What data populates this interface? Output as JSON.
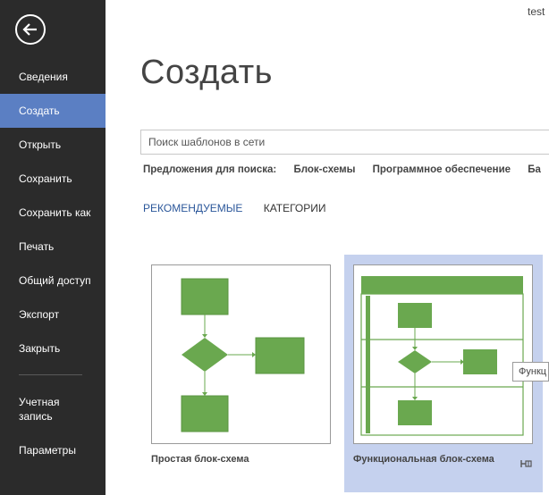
{
  "user": {
    "name": "test"
  },
  "sidebar": {
    "items": [
      {
        "label": "Сведения"
      },
      {
        "label": "Создать",
        "active": true
      },
      {
        "label": "Открыть"
      },
      {
        "label": "Сохранить"
      },
      {
        "label": "Сохранить как"
      },
      {
        "label": "Печать"
      },
      {
        "label": "Общий доступ"
      },
      {
        "label": "Экспорт"
      },
      {
        "label": "Закрыть"
      },
      {
        "label": "Учетная запись"
      },
      {
        "label": "Параметры"
      }
    ]
  },
  "main": {
    "title": "Создать",
    "search": {
      "placeholder": "Поиск шаблонов в сети",
      "value": ""
    },
    "suggestions": {
      "label": "Предложения для поиска:",
      "items": [
        "Блок-схемы",
        "Программное обеспечение",
        "Ба"
      ]
    },
    "tabs": [
      {
        "label": "РЕКОМЕНДУЕМЫЕ",
        "active": true
      },
      {
        "label": "КАТЕГОРИИ",
        "active": false
      }
    ],
    "templates": [
      {
        "label": "Простая блок-схема"
      },
      {
        "label": "Функциональная блок-схема",
        "highlighted": true
      }
    ],
    "tooltip": "Функц"
  },
  "colors": {
    "sidebar_bg": "#2b2b2b",
    "sidebar_active": "#5b7fc3",
    "accent": "#2b579a",
    "shape_green": "#6aa84f",
    "tile_highlight": "#c5d1ee"
  },
  "icons": {
    "back": "arrow-left-circle-icon",
    "pin": "pin-icon"
  }
}
